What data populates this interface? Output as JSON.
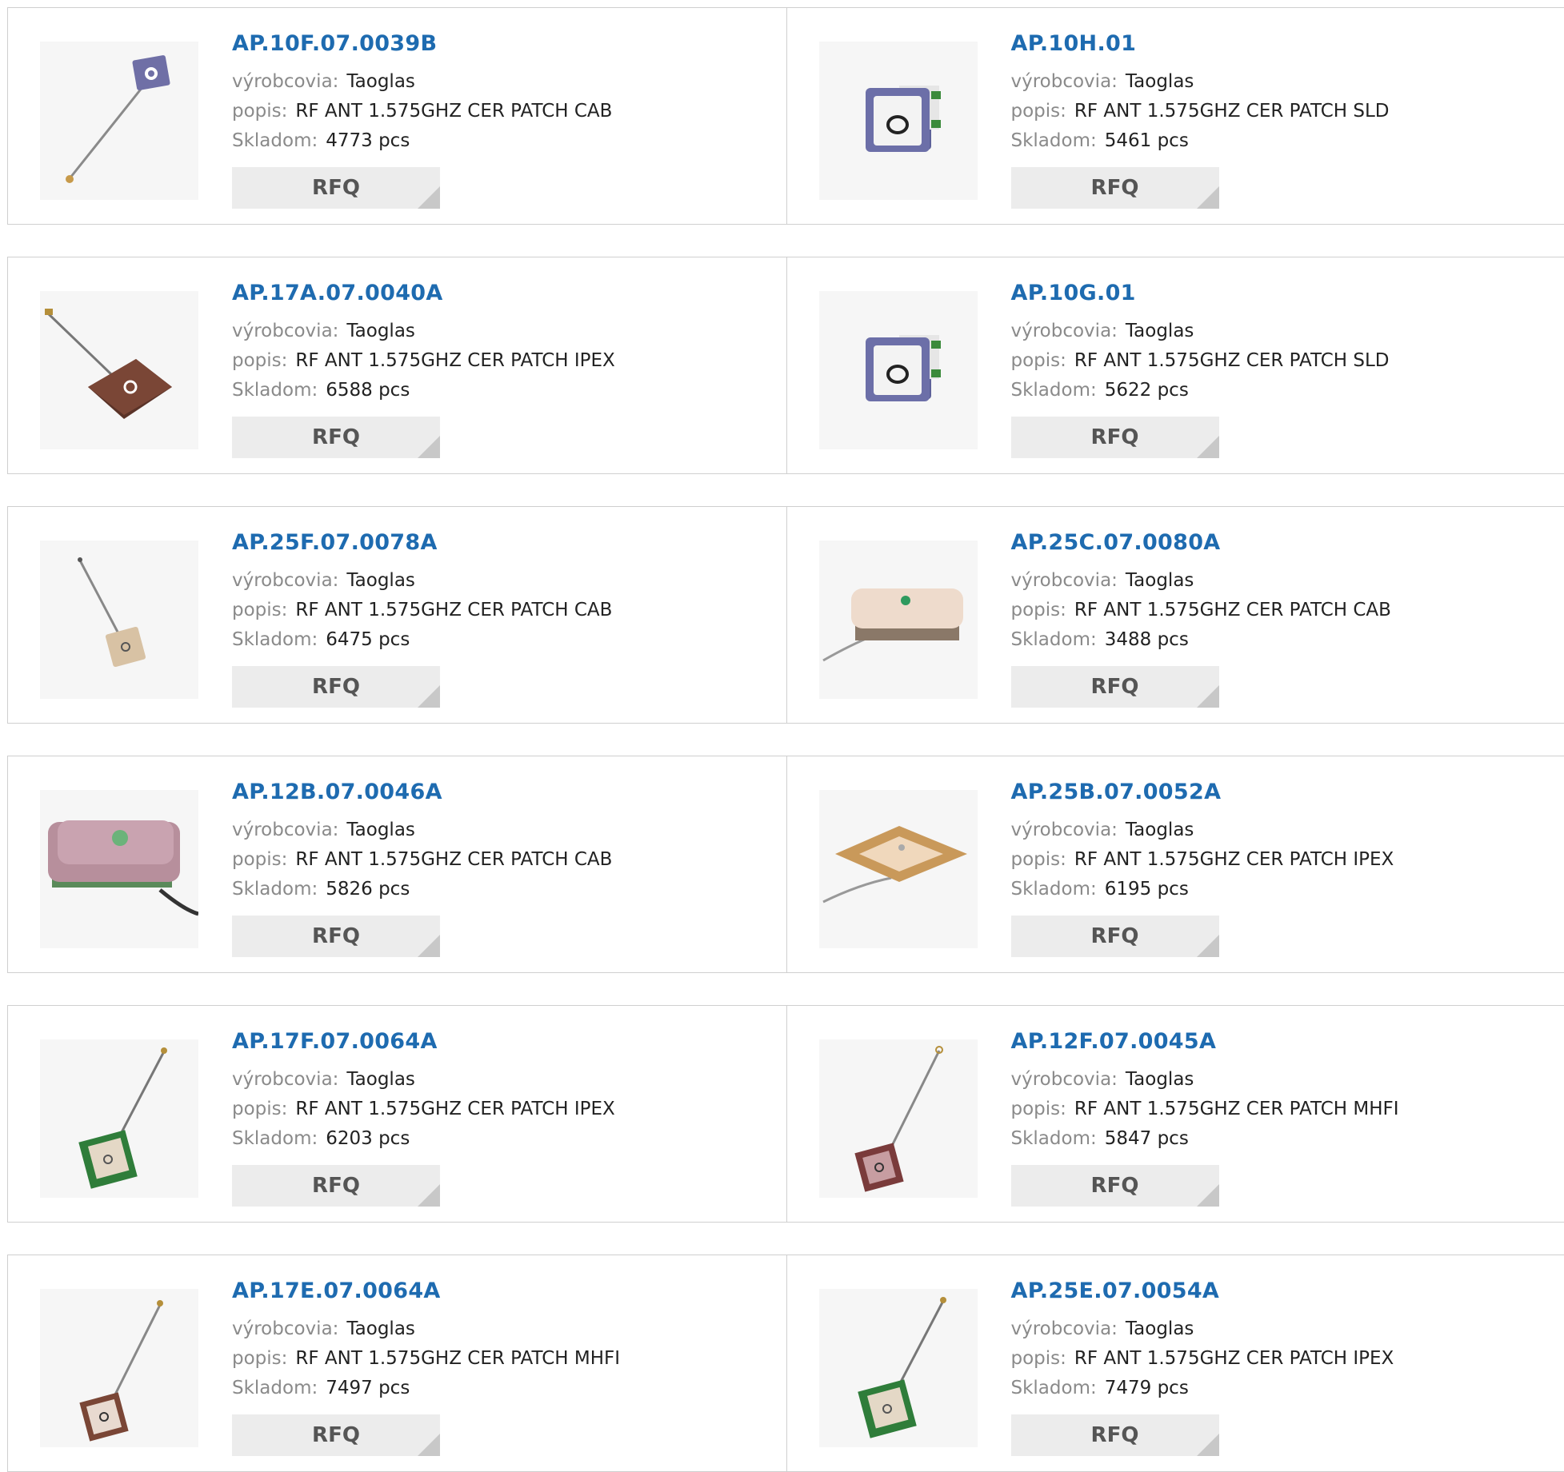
{
  "labels": {
    "manufacturer": "výrobcovia:",
    "description": "popis:",
    "stock": "Skladom:",
    "rfq": "RFQ"
  },
  "products": [
    {
      "pn": "AP.10F.07.0039B",
      "manufacturer": "Taoglas",
      "description": "RF ANT 1.575GHZ CER PATCH CAB",
      "stock": "4773 pcs",
      "image": "small-purple-patch-with-cable"
    },
    {
      "pn": "AP.10H.01",
      "manufacturer": "Taoglas",
      "description": "RF ANT 1.575GHZ CER PATCH SLD",
      "stock": "5461 pcs",
      "image": "purple-cube-patch-smd"
    },
    {
      "pn": "AP.17A.07.0040A",
      "manufacturer": "Taoglas",
      "description": "RF ANT 1.575GHZ CER PATCH IPEX",
      "stock": "6588 pcs",
      "image": "brown-patch-with-cable"
    },
    {
      "pn": "AP.10G.01",
      "manufacturer": "Taoglas",
      "description": "RF ANT 1.575GHZ CER PATCH SLD",
      "stock": "5622 pcs",
      "image": "purple-cube-patch-smd"
    },
    {
      "pn": "AP.25F.07.0078A",
      "manufacturer": "Taoglas",
      "description": "RF ANT 1.575GHZ CER PATCH CAB",
      "stock": "6475 pcs",
      "image": "beige-patch-with-cable"
    },
    {
      "pn": "AP.25C.07.0080A",
      "manufacturer": "Taoglas",
      "description": "RF ANT 1.575GHZ CER PATCH CAB",
      "stock": "3488 pcs",
      "image": "beige-flat-patch-with-cable"
    },
    {
      "pn": "AP.12B.07.0046A",
      "manufacturer": "Taoglas",
      "description": "RF ANT 1.575GHZ CER PATCH CAB",
      "stock": "5826 pcs",
      "image": "pink-large-patch-with-cable"
    },
    {
      "pn": "AP.25B.07.0052A",
      "manufacturer": "Taoglas",
      "description": "RF ANT 1.575GHZ CER PATCH IPEX",
      "stock": "6195 pcs",
      "image": "tan-flat-patch-with-cable"
    },
    {
      "pn": "AP.17F.07.0064A",
      "manufacturer": "Taoglas",
      "description": "RF ANT 1.575GHZ CER PATCH IPEX",
      "stock": "6203 pcs",
      "image": "green-pcb-patch-with-cable"
    },
    {
      "pn": "AP.12F.07.0045A",
      "manufacturer": "Taoglas",
      "description": "RF ANT 1.575GHZ CER PATCH MHFI",
      "stock": "5847 pcs",
      "image": "maroon-patch-with-cable"
    },
    {
      "pn": "AP.17E.07.0064A",
      "manufacturer": "Taoglas",
      "description": "RF ANT 1.575GHZ CER PATCH MHFI",
      "stock": "7497 pcs",
      "image": "brown-small-patch-with-cable"
    },
    {
      "pn": "AP.25E.07.0054A",
      "manufacturer": "Taoglas",
      "description": "RF ANT 1.575GHZ CER PATCH IPEX",
      "stock": "7479 pcs",
      "image": "green-pcb-patch-with-cable"
    }
  ],
  "colors": {
    "link": "#1e6bb0",
    "label": "#8a8a8a",
    "button_bg": "#ececec",
    "border": "#cfcfcf"
  }
}
